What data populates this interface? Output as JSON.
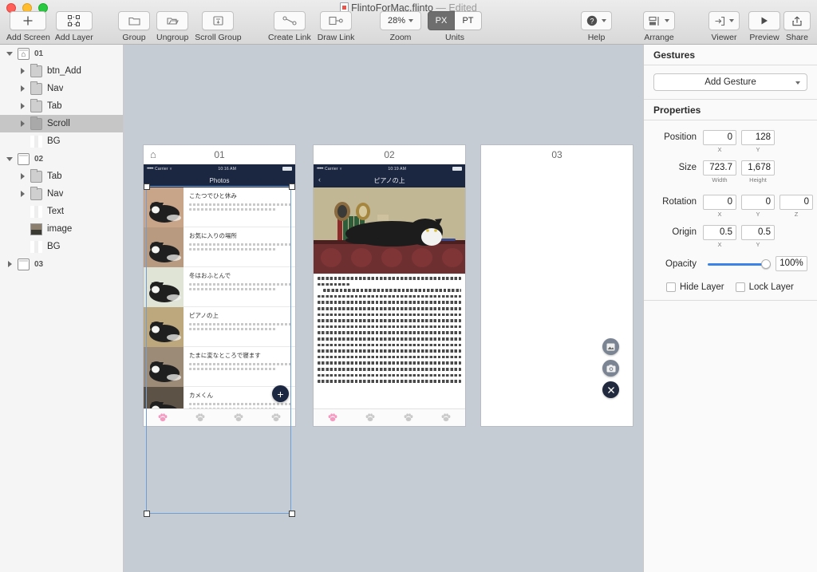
{
  "window": {
    "title": "FlintoForMac.flinto",
    "separator": "—",
    "edited": "Edited",
    "doc_icon": "document-icon",
    "traffic_lights": [
      "close",
      "minimize",
      "zoom"
    ]
  },
  "toolbar": {
    "items": [
      {
        "label": "Add Screen",
        "icon": "plus-icon"
      },
      {
        "label": "Add Layer",
        "icon": "layer-frame-icon"
      },
      {
        "label": "Group",
        "icon": "folder-closed-icon"
      },
      {
        "label": "Ungroup",
        "icon": "folder-open-icon"
      },
      {
        "label": "Scroll Group",
        "icon": "scroll-group-icon"
      },
      {
        "label": "Create Link",
        "icon": "create-link-icon"
      },
      {
        "label": "Draw Link",
        "icon": "draw-link-icon"
      }
    ],
    "zoom": {
      "value": "28%",
      "label": "Zoom"
    },
    "units": {
      "label": "Units",
      "options": [
        "PX",
        "PT"
      ],
      "selected": "PX"
    },
    "help": {
      "label": "Help",
      "icon": "question-mark-icon"
    },
    "arrange": {
      "label": "Arrange",
      "icon": "arrange-icon"
    },
    "viewer": {
      "label": "Viewer",
      "icon": "viewer-icon"
    },
    "preview": {
      "label": "Preview",
      "icon": "play-icon"
    },
    "share": {
      "label": "Share",
      "icon": "share-icon"
    }
  },
  "sidebar": {
    "layers": [
      {
        "label": "01",
        "indent": 0,
        "icon": "screen-home-icon",
        "disclosure": "open",
        "selected": false
      },
      {
        "label": "btn_Add",
        "indent": 1,
        "icon": "folder-icon",
        "disclosure": "closed",
        "selected": false
      },
      {
        "label": "Nav",
        "indent": 1,
        "icon": "folder-icon",
        "disclosure": "closed",
        "selected": false
      },
      {
        "label": "Tab",
        "indent": 1,
        "icon": "folder-icon",
        "disclosure": "closed",
        "selected": false
      },
      {
        "label": "Scroll",
        "indent": 1,
        "icon": "folder-dark-icon",
        "disclosure": "closed",
        "selected": true
      },
      {
        "label": "BG",
        "indent": 1,
        "icon": "rect-layer-icon",
        "disclosure": "none",
        "selected": false
      },
      {
        "label": "02",
        "indent": 0,
        "icon": "screen-icon",
        "disclosure": "open",
        "selected": false
      },
      {
        "label": "Tab",
        "indent": 1,
        "icon": "folder-icon",
        "disclosure": "closed",
        "selected": false
      },
      {
        "label": "Nav",
        "indent": 1,
        "icon": "folder-icon",
        "disclosure": "closed",
        "selected": false
      },
      {
        "label": "Text",
        "indent": 1,
        "icon": "rect-layer-icon",
        "disclosure": "none",
        "selected": false
      },
      {
        "label": "image",
        "indent": 1,
        "icon": "image-layer-icon",
        "disclosure": "none",
        "selected": false
      },
      {
        "label": "BG",
        "indent": 1,
        "icon": "rect-layer-icon",
        "disclosure": "none",
        "selected": false
      },
      {
        "label": "03",
        "indent": 0,
        "icon": "screen-icon",
        "disclosure": "closed",
        "selected": false
      }
    ]
  },
  "canvas": {
    "background_color": "#c6ccd4",
    "screens": [
      {
        "name": "01",
        "has_home_badge": true,
        "status_bar": {
          "carrier": "Carrier",
          "signal": "•••••",
          "wifi": "wifi-icon",
          "time": "10:16 AM",
          "battery": "battery-icon"
        },
        "nav_title": "Photos",
        "cells": [
          {
            "title": "こたつでひと休み",
            "thumb_color": "#c8a489"
          },
          {
            "title": "お気に入りの場所",
            "thumb_color": "#b79a80"
          },
          {
            "title": "冬はおふとんで",
            "thumb_color": "#dfe4d7"
          },
          {
            "title": "ピアノの上",
            "thumb_color": "#bda87e"
          },
          {
            "title": "たまに変なところで寝ます",
            "thumb_color": "#9c8b77"
          },
          {
            "title": "カメくん",
            "thumb_color": "#5d5246"
          }
        ],
        "fab": {
          "icon": "plus-icon",
          "label": "+"
        },
        "tabs": [
          {
            "icon": "paw-icon",
            "active": true
          },
          {
            "icon": "paw-icon",
            "active": false
          },
          {
            "icon": "paw-icon",
            "active": false
          },
          {
            "icon": "paw-icon",
            "active": false
          }
        ]
      },
      {
        "name": "02",
        "has_home_badge": false,
        "status_bar": {
          "carrier": "Carrier",
          "signal": "•••••",
          "wifi": "wifi-icon",
          "time": "10:19 AM",
          "battery": "battery-icon"
        },
        "nav_title": "ピアノの上",
        "back_icon": "chevron-left-icon",
        "hero_image": "cat-on-piano-photo",
        "body_lines": 18,
        "tabs": [
          {
            "icon": "paw-icon",
            "active": true
          },
          {
            "icon": "paw-icon",
            "active": false
          },
          {
            "icon": "paw-icon",
            "active": false
          },
          {
            "icon": "paw-icon",
            "active": false
          }
        ]
      },
      {
        "name": "03",
        "has_home_badge": false,
        "empty": true,
        "floating_buttons": [
          {
            "icon": "photo-library-icon",
            "style": "gray"
          },
          {
            "icon": "camera-icon",
            "style": "gray"
          },
          {
            "icon": "close-x-icon",
            "style": "dark"
          }
        ]
      }
    ]
  },
  "inspector": {
    "gestures": {
      "heading": "Gestures",
      "add_gesture_label": "Add Gesture"
    },
    "properties": {
      "heading": "Properties",
      "position": {
        "label": "Position",
        "x": "0",
        "y": "128",
        "x_sub": "X",
        "y_sub": "Y"
      },
      "size": {
        "label": "Size",
        "width": "723.7",
        "height": "1,678",
        "width_sub": "Width",
        "height_sub": "Height"
      },
      "rotation": {
        "label": "Rotation",
        "x": "0",
        "y": "0",
        "z": "0",
        "x_sub": "X",
        "y_sub": "Y",
        "z_sub": "Z"
      },
      "origin": {
        "label": "Origin",
        "x": "0.5",
        "y": "0.5",
        "x_sub": "X",
        "y_sub": "Y"
      },
      "opacity": {
        "label": "Opacity",
        "value": "100%",
        "percent": 100
      },
      "hide_layer": {
        "label": "Hide Layer",
        "checked": false
      },
      "lock_layer": {
        "label": "Lock Layer",
        "checked": false
      }
    }
  }
}
